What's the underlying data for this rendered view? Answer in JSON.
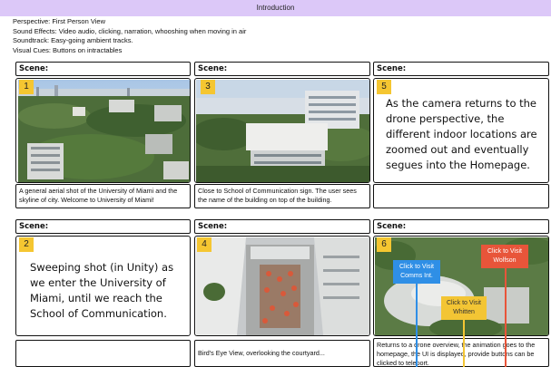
{
  "header": {
    "title": "Introduction"
  },
  "meta": {
    "perspective": "Perspective: First Person View",
    "sound_effects": "Sound Effects: Video audio, clicking, narration, whooshing when moving in air",
    "soundtrack": "Soundtrack: Easy-going ambient tracks.",
    "visual_cues": "Visual Cues: Buttons on intractables"
  },
  "scene_label": "Scene:",
  "scenes": [
    {
      "number": "1",
      "caption": "A general aerial shot of the University of Miami and the skyline of city. Welcome to University of Miami!"
    },
    {
      "number": "3",
      "caption": "Close to School of Communication sign. The user sees the name of the building on top of the building."
    },
    {
      "number": "5",
      "text": "As the camera returns to the drone perspective, the different indoor locations are zoomed out and eventually segues into the Homepage.",
      "caption": ""
    },
    {
      "number": "2",
      "text": "Sweeping shot (in Unity) as we enter the University of Miami, until we reach the School of Communication.",
      "caption": ""
    },
    {
      "number": "4",
      "caption": "Bird's Eye View, overlooking the courtyard..."
    },
    {
      "number": "6",
      "caption": "Returns to a drone overview, the animation goes to the homepage, the UI is displayed, provide buttons can be clicked to teleport."
    }
  ],
  "hotspots": {
    "comms": "Click to Visit Comms Int.",
    "whitten": "Click to Visit Whitten",
    "wolfson": "Click to Visit Wolfson"
  },
  "colors": {
    "header_bg": "#dcc8f8",
    "number_badge": "#f5c631",
    "hotspot_blue": "#2f8fe6",
    "hotspot_yellow": "#f3c534",
    "hotspot_red": "#e8553a"
  }
}
